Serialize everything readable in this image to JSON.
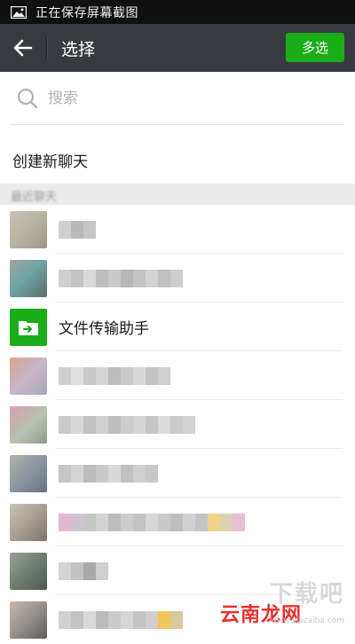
{
  "status_bar": {
    "text": "正在保存屏幕截图",
    "icon": "image-icon"
  },
  "header": {
    "title": "选择",
    "multi_select_label": "多选",
    "back_icon": "back-arrow-icon",
    "accent": "#1aad19"
  },
  "search": {
    "placeholder": "搜索",
    "value": ""
  },
  "new_chat": {
    "label": "创建新聊天"
  },
  "section": {
    "label": "最近聊天"
  },
  "file_helper": {
    "label": "文件传输助手",
    "icon": "folder-arrow-icon"
  },
  "watermark": {
    "top": "下载吧",
    "main": "云南龙网",
    "url": "www.xiazaiba.com"
  }
}
